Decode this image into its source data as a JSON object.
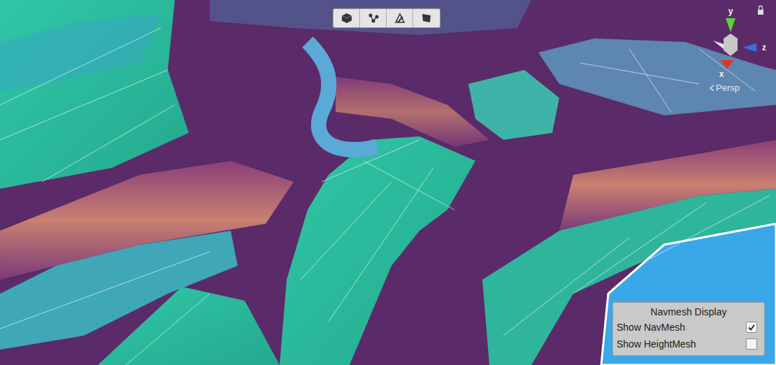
{
  "scene_view": {
    "projection": "Persp"
  },
  "orientation_gizmo": {
    "axes": [
      {
        "label": "y",
        "color": "#5fd13a"
      },
      {
        "label": "z",
        "color": "#3b6fe0"
      },
      {
        "label": "x",
        "color": "#e0342a"
      }
    ]
  },
  "navmesh_display": {
    "title": "Navmesh Display",
    "options": [
      {
        "label": "Show NavMesh",
        "checked": true
      },
      {
        "label": "Show HeightMesh",
        "checked": false
      }
    ]
  }
}
